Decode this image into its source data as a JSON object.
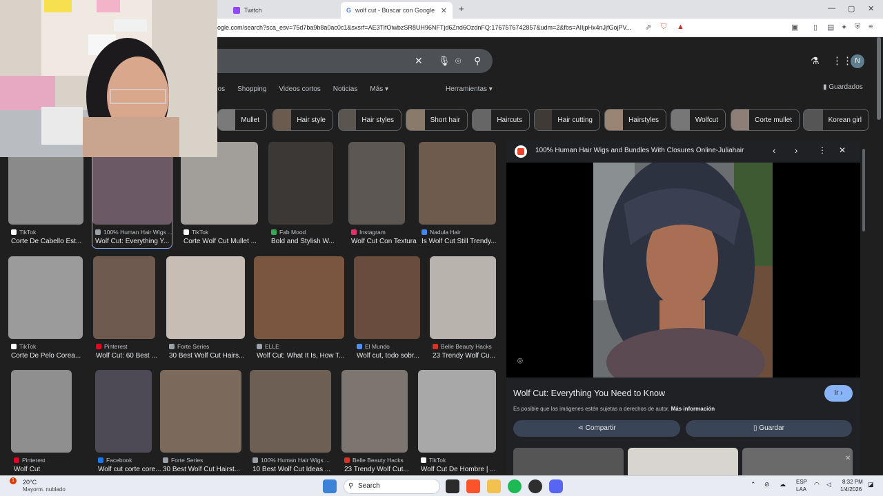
{
  "browser": {
    "tabs": [
      {
        "title": "Twitch",
        "active": false
      },
      {
        "title": "wolf cut - Buscar con Google",
        "active": true
      }
    ],
    "new_tab_label": "+",
    "url": "oogle.com/search?sca_esv=75d7ba9b8a0ac0c1&sxsrf=AE3TifOiwbzSR8UH96NFTjd6Znd6OzdnFQ:1767576742857&udm=2&fbs=AIIjpHx4nJjfGojPV..."
  },
  "google": {
    "filters": [
      "eos",
      "Shopping",
      "Videos cortos",
      "Noticias",
      "Más ▾"
    ],
    "tools_label": "Herramientas ▾",
    "saved_label": "Guardados",
    "profile_initial": "N",
    "chips": [
      "Mullet",
      "Hair style",
      "Hair styles",
      "Short hair",
      "Haircuts",
      "Hair cutting",
      "Hairstyles",
      "Wolfcut",
      "Corte mullet",
      "Korean girl"
    ]
  },
  "results": [
    {
      "source": "TikTok",
      "title": "Corte De Cabello Est...",
      "color": "#8a8a8a"
    },
    {
      "source": "100% Human Hair Wigs ...",
      "title": "Wolf Cut: Everything Y...",
      "color": "#6b5a66"
    },
    {
      "source": "TikTok",
      "title": "Corte Wolf Cut Mullet ...",
      "color": "#a29e9a"
    },
    {
      "source": "Fab Mood",
      "title": "Bold and Stylish W...",
      "color": "#3b3836"
    },
    {
      "source": "Instagram",
      "title": "Wolf Cut Con Textura",
      "color": "#5c5752"
    },
    {
      "source": "Nadula Hair",
      "title": "Is Wolf Cut Still Trendy...",
      "color": "#6f5a4e"
    },
    {
      "source": "TikTok",
      "title": "Corte De Pelo Corea...",
      "color": "#9b9b9b"
    },
    {
      "source": "Pinterest",
      "title": "Wolf Cut: 60 Best ...",
      "color": "#6e5a4f"
    },
    {
      "source": "Forte Series",
      "title": "30 Best Wolf Cut Hairs...",
      "color": "#c8bdb4"
    },
    {
      "source": "ELLE",
      "title": "Wolf Cut: What It Is, How T...",
      "color": "#7a5540"
    },
    {
      "source": "El Mundo",
      "title": "Wolf cut, todo sobr...",
      "color": "#6a4c3f"
    },
    {
      "source": "Belle Beauty Hacks",
      "title": "23 Trendy Wolf Cu...",
      "color": "#b9b3ad"
    },
    {
      "source": "Pinterest",
      "title": "Wolf Cut",
      "color": "#8f8f8f"
    },
    {
      "source": "Facebook",
      "title": "Wolf cut corte core...",
      "color": "#4e4a55"
    },
    {
      "source": "Forte Series",
      "title": "30 Best Wolf Cut Hairst...",
      "color": "#7b6a5b"
    },
    {
      "source": "100% Human Hair Wigs ...",
      "title": "10 Best Wolf Cut Ideas ...",
      "color": "#6e5f55"
    },
    {
      "source": "Belle Beauty Hacks",
      "title": "23 Trendy Wolf Cut...",
      "color": "#7d7670"
    },
    {
      "source": "TikTok",
      "title": "Wolf Cut De Hombre | ...",
      "color": "#a8a8a8"
    }
  ],
  "preview": {
    "site_title": "100% Human Hair Wigs and Bundles With Closures Online-Juliahair",
    "caption": "Wolf Cut: Everything You Need to Know",
    "go_label": "Ir ›",
    "copyright_note": "Es posible que las imágenes estén sujetas a derechos de autor.",
    "more_info": "Más información",
    "share_label": "Compartir",
    "save_label": "Guardar"
  },
  "taskbar": {
    "weather_temp": "20°C",
    "weather_desc": "Mayorm. nublado",
    "search_label": "Search",
    "lang_top": "ESP",
    "lang_bottom": "LAA",
    "time": "8:32 PM",
    "date": "1/4/2026",
    "notification_count": "1"
  },
  "colors": {
    "page_bg": "#1f1f1f",
    "accent_blue": "#8ab4f8",
    "button_bg": "#394457"
  }
}
